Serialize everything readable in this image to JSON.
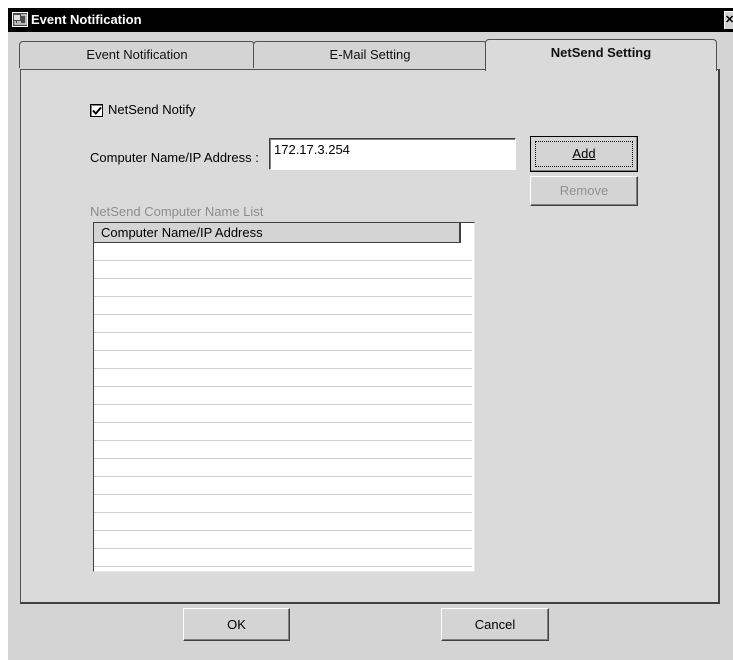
{
  "window": {
    "title": "Event Notification",
    "close_glyph": "✕"
  },
  "tabs": [
    {
      "label": "Event Notification"
    },
    {
      "label": "E-Mail Setting"
    },
    {
      "label": "NetSend Setting"
    }
  ],
  "netsend": {
    "notify_label": "NetSend Notify",
    "notify_checked": true,
    "address_label": "Computer Name/IP Address :",
    "address_value": "172.17.3.254",
    "add_label": "Add",
    "remove_label": "Remove",
    "list_caption": "NetSend Computer Name List",
    "list_column": "Computer Name/IP Address"
  },
  "footer": {
    "ok_label": "OK",
    "cancel_label": "Cancel"
  },
  "icons": {
    "app": "event-notification-icon",
    "close": "close-icon",
    "check": "checkmark-icon"
  }
}
